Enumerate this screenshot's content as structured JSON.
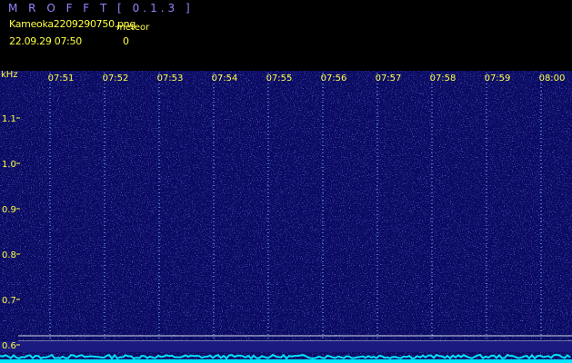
{
  "header": {
    "app_title": "M R O F F T  [ 0.1.3 ]",
    "file_name": "Kameoka2209290750.png",
    "meteor_label": "meteor",
    "timestamp": "22.09.29 07:50",
    "meteor_count": "0"
  },
  "spectrogram": {
    "unit_label": "kHz",
    "time_labels": [
      "07:51",
      "07:52",
      "07:53",
      "07:54",
      "07:55",
      "07:56",
      "07:57",
      "07:58",
      "07:59",
      "08:00"
    ],
    "freq_labels": [
      "1.1",
      "1.0",
      "0.9",
      "0.8",
      "0.7",
      "0.6"
    ],
    "colors": {
      "background": "#0a0a62",
      "grid": "#ffffff",
      "text": "#ffff44",
      "noise_floor": "#00e5ff"
    }
  }
}
